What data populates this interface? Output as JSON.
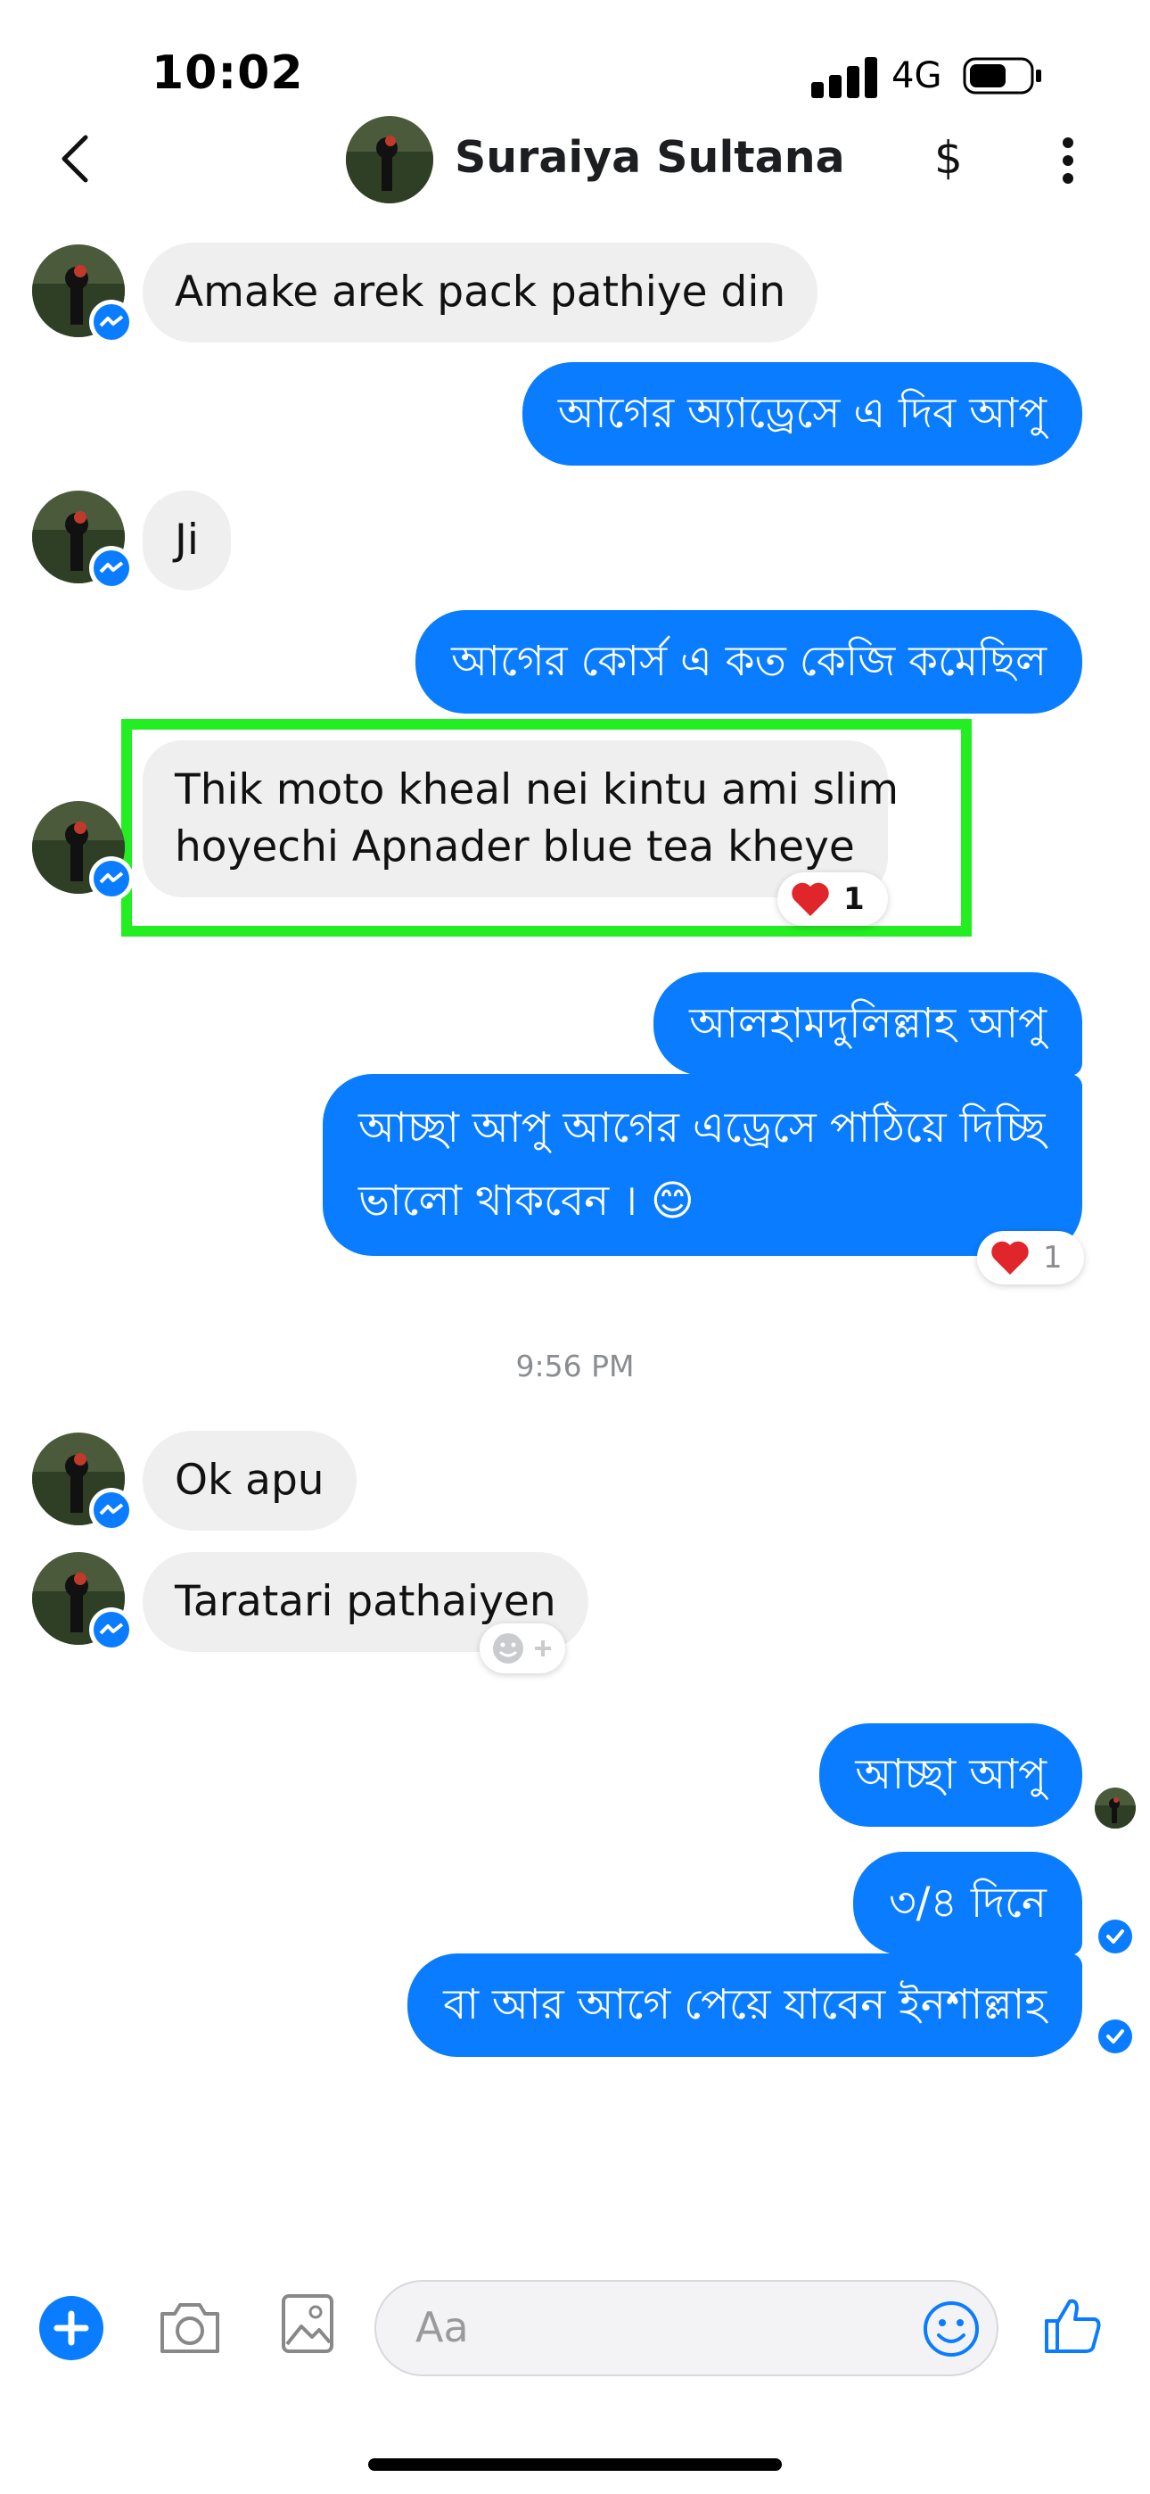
{
  "status_bar": {
    "time": "10:02",
    "network": "4G"
  },
  "header": {
    "contact_name": "Suraiya Sultana",
    "payment_label": "$"
  },
  "messages": [
    {
      "dir": "in",
      "text": "Amake arek pack pathiye din"
    },
    {
      "dir": "out",
      "text": "আগের অ্যাড্রেসে এ দিব আপু"
    },
    {
      "dir": "in",
      "text": "Ji"
    },
    {
      "dir": "out",
      "text": "আগের কোর্স এ কত কেজি কমেছিল"
    },
    {
      "dir": "in",
      "line1": "Thik moto kheal nei kintu ami slim",
      "line2": "hoyechi  Apnader blue tea kheye",
      "reaction_count": "1"
    },
    {
      "dir": "out",
      "text": "আলহামদুলিল্লাহ আপু"
    },
    {
      "dir": "out",
      "line1": "আচ্ছা আপু আগের এড্রেসে পাঠিয়ে দিচ্ছি",
      "line2": "ভালো থাকবেন । 😊",
      "reaction_count": "1"
    },
    {
      "dir": "in",
      "text": "Ok apu"
    },
    {
      "dir": "in",
      "text": "Taratari pathaiyen"
    },
    {
      "dir": "out",
      "text": "আচ্ছা আপু"
    },
    {
      "dir": "out",
      "text": "৩/৪ দিনে"
    },
    {
      "dir": "out",
      "text": "বা আর আগে পেয়ে যাবেন ইনশাল্লাহ"
    }
  ],
  "timestamp": "9:56 PM",
  "composer": {
    "placeholder": "Aa"
  },
  "colors": {
    "accent": "#0a7cff",
    "incoming_bubble": "#efefef",
    "highlight": "#22ee22"
  },
  "icons": [
    "back-chevron-icon",
    "dollar-icon",
    "more-vertical-icon",
    "plus-icon",
    "camera-icon",
    "gallery-icon",
    "emoji-icon",
    "thumbs-up-icon",
    "messenger-badge-icon",
    "heart-icon",
    "add-reaction-icon",
    "check-icon"
  ]
}
